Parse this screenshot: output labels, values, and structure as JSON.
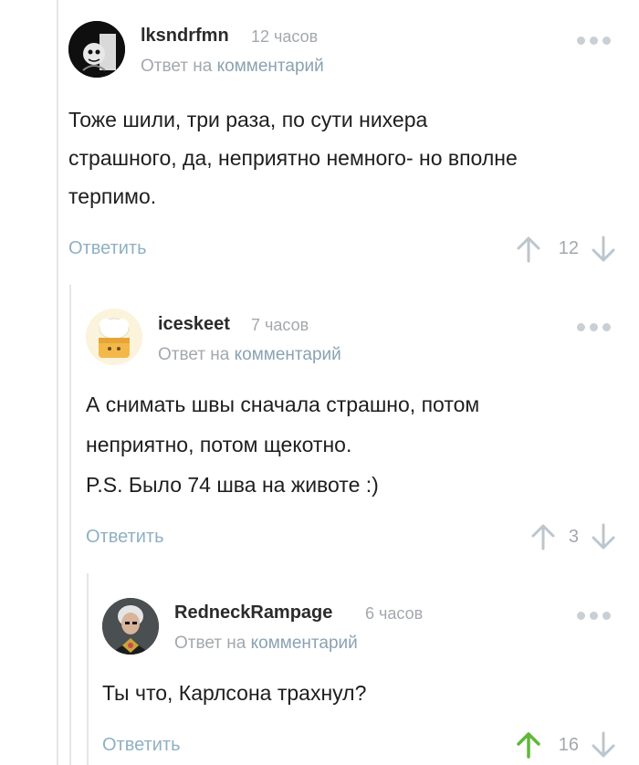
{
  "comments": [
    {
      "author": "lksndrfmn",
      "time": "12 часов",
      "reply_prefix": "Ответ на",
      "reply_link": "комментарий",
      "lines": [
        "Тоже шили, три раза, по сути нихера",
        "страшного, да, неприятно немного- но вполне",
        "терпимо."
      ],
      "reply_label": "Ответить",
      "rating": "12",
      "upvoted": false
    },
    {
      "author": "iceskeet",
      "time": "7 часов",
      "reply_prefix": "Ответ на",
      "reply_link": "комментарий",
      "lines": [
        "А снимать швы сначала страшно, потом",
        "неприятно, потом щекотно.",
        "P.S. Было 74 шва на животе :)"
      ],
      "reply_label": "Ответить",
      "rating": "3",
      "upvoted": false
    },
    {
      "author": "RedneckRampage",
      "time": "6 часов",
      "reply_prefix": "Ответ на",
      "reply_link": "комментарий",
      "lines": [
        "Ты что, Карлсона трахнул?"
      ],
      "reply_label": "Ответить",
      "rating": "16",
      "upvoted": true
    }
  ],
  "colors": {
    "link": "#8fb0c3",
    "muted": "#a3a8ad",
    "upvote_active": "#5fb83a",
    "arrow": "#bcc6cd",
    "thread_line": "#e4e6e8"
  }
}
